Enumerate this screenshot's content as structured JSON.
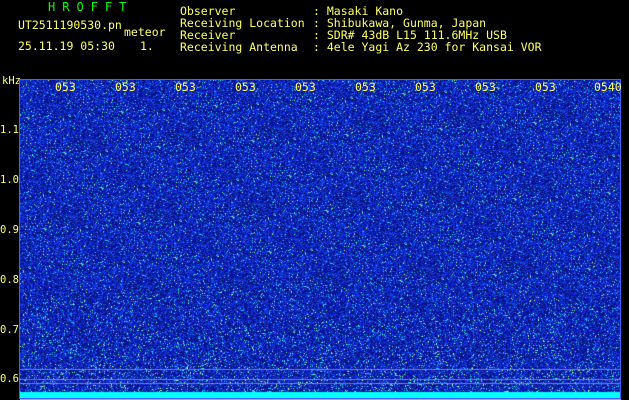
{
  "header": {
    "app_title": "HROFFT",
    "file_name": "UT2511190530.pn",
    "meteor_label": "meteor",
    "date_time": "25.11.19 05:30",
    "count": "1."
  },
  "meta": [
    {
      "key": "Observer",
      "sep": ": ",
      "value": "Masaki Kano"
    },
    {
      "key": "Receiving Location",
      "sep": ": ",
      "value": "Shibukawa, Gunma, Japan"
    },
    {
      "key": "Receiver",
      "sep": ": ",
      "value": "SDR# 43dB L15 111.6MHz USB"
    },
    {
      "key": "Receiving Antenna",
      "sep": ": ",
      "value": "4ele Yagi Az 230 for Kansai VOR"
    }
  ],
  "axis": {
    "unit_label": "kHz",
    "freq_ticks": [
      "1.1",
      "1.0",
      "0.9",
      "0.8",
      "0.7",
      "0.6"
    ],
    "time_ticks": [
      "053",
      "053",
      "053",
      "053",
      "053",
      "053",
      "053",
      "053",
      "053",
      "0540"
    ]
  },
  "colors": {
    "background": "#000000",
    "label_text": "#ffff66",
    "title_text": "#00ff00",
    "noise_base": "#1e2fc0",
    "baseline_band": "#00ffff"
  }
}
